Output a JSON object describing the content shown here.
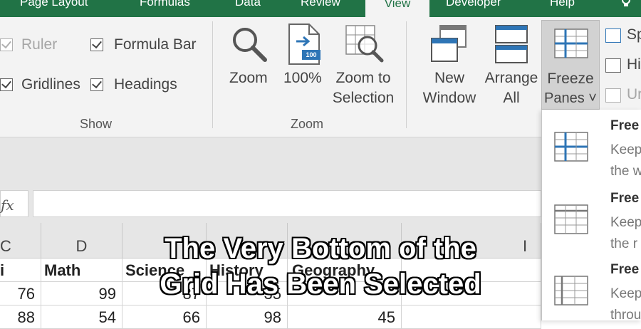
{
  "tabs": [
    "Page Layout",
    "Formulas",
    "Data",
    "Review",
    "View",
    "Developer",
    "Help"
  ],
  "show_group": {
    "label": "Show",
    "ruler": "Ruler",
    "formula_bar": "Formula Bar",
    "gridlines": "Gridlines",
    "headings": "Headings"
  },
  "zoom_group": {
    "label": "Zoom",
    "zoom": "Zoom",
    "hundred": "100%",
    "hundred_badge": "100",
    "zoom_to": "Zoom to",
    "selection": "Selection"
  },
  "window_group": {
    "new": "New",
    "window": "Window",
    "arrange": "Arrange",
    "all": "All",
    "freeze": "Freeze",
    "panes": "Panes ˅",
    "split": "Sp",
    "hide": "Hi",
    "unhide": "Ur"
  },
  "formula_bar": {
    "fx": "fx",
    "value": ""
  },
  "grid": {
    "columns": [
      "C",
      "D",
      "",
      "",
      "",
      "I"
    ],
    "header_row": [
      "i",
      "Math",
      "Science",
      "History",
      "Geography",
      ""
    ],
    "rows": [
      [
        "76",
        "99",
        "87",
        "35",
        "",
        ""
      ],
      [
        "88",
        "54",
        "66",
        "98",
        "45",
        ""
      ]
    ]
  },
  "freeze_menu": [
    {
      "title": "Free",
      "desc1": "Keep",
      "desc2": "the w"
    },
    {
      "title": "Free",
      "desc1": "Keep",
      "desc2": "the r"
    },
    {
      "title": "Free",
      "desc1": "Keep",
      "desc2": "throu"
    }
  ],
  "caption": {
    "line1": "The Very Bottom of the",
    "line2": "Grid Has Been Selected"
  },
  "colors": {
    "excel_green": "#217346",
    "ribbon_bg": "#f3f3f3",
    "accent_blue": "#2e75b6"
  }
}
